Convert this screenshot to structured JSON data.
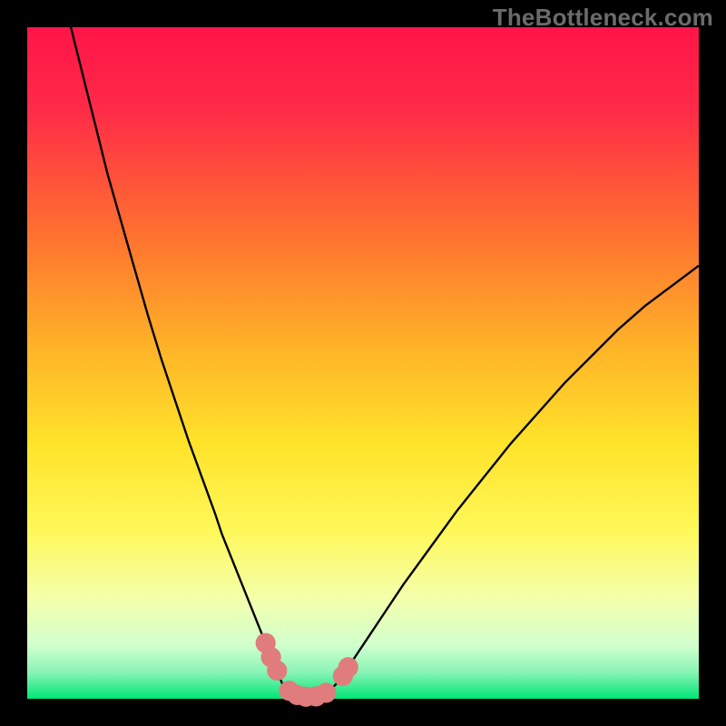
{
  "watermark": "TheBottleneck.com",
  "colors": {
    "frame": "#000000",
    "gradient_top": "#ff1744",
    "gradient_mid1": "#ff8e25",
    "gradient_mid2": "#ffe600",
    "gradient_low": "#f6ffb3",
    "gradient_bottom": "#00e676",
    "curve": "#000000",
    "marker": "#e07c7c"
  },
  "chart_data": {
    "type": "line",
    "title": "",
    "xlabel": "",
    "ylabel": "",
    "xlim": [
      0,
      100
    ],
    "ylim": [
      0,
      100
    ],
    "series": [
      {
        "name": "left-branch",
        "x": [
          6.5,
          8,
          10,
          12,
          14,
          16,
          18,
          20,
          22,
          24,
          26,
          28,
          29,
          30,
          31,
          32,
          33,
          34,
          35,
          36,
          37,
          38
        ],
        "values": [
          100,
          94,
          86,
          78,
          71,
          64,
          57,
          50.5,
          44.5,
          38.5,
          33,
          27.5,
          24.5,
          22,
          19.5,
          17,
          14.5,
          12,
          9.5,
          7,
          4.5,
          2.2
        ]
      },
      {
        "name": "valley",
        "x": [
          38,
          38.8,
          39.6,
          40.4,
          41.2,
          42,
          42.8,
          43.6,
          44.4,
          45.2,
          46
        ],
        "values": [
          2.2,
          1.4,
          0.85,
          0.5,
          0.3,
          0.25,
          0.3,
          0.5,
          0.85,
          1.4,
          2.2
        ]
      },
      {
        "name": "right-branch",
        "x": [
          46,
          48,
          50,
          53,
          56,
          60,
          64,
          68,
          72,
          76,
          80,
          84,
          88,
          92,
          96,
          100
        ],
        "values": [
          2.2,
          5,
          8,
          12.5,
          17,
          22.5,
          28,
          33,
          38,
          42.5,
          47,
          51,
          55,
          58.5,
          61.5,
          64.5
        ]
      }
    ],
    "markers": {
      "name": "highlight-points",
      "points": [
        {
          "x": 35.5,
          "y": 8.3
        },
        {
          "x": 36.3,
          "y": 6.2
        },
        {
          "x": 37.2,
          "y": 4.2
        },
        {
          "x": 39.0,
          "y": 1.2
        },
        {
          "x": 40.2,
          "y": 0.55
        },
        {
          "x": 41.5,
          "y": 0.3
        },
        {
          "x": 43.0,
          "y": 0.35
        },
        {
          "x": 44.5,
          "y": 0.9
        },
        {
          "x": 47.0,
          "y": 3.4
        },
        {
          "x": 47.8,
          "y": 4.7
        }
      ],
      "radius_pct": 1.5
    }
  }
}
